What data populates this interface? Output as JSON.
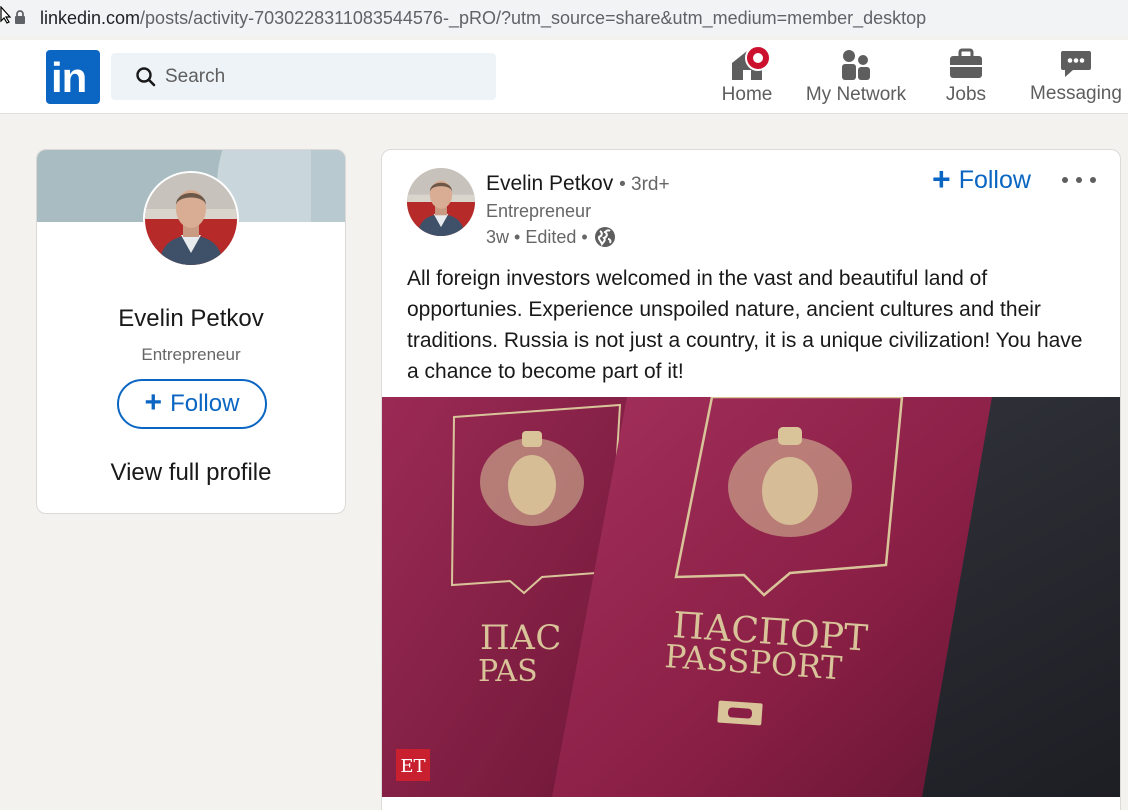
{
  "browser": {
    "url_host": "linkedin.com",
    "url_path": "/posts/activity-7030228311083544576-_pRO/?utm_source=share&utm_medium=member_desktop"
  },
  "nav": {
    "search_placeholder": "Search",
    "items": [
      {
        "label": "Home",
        "icon": "home-icon",
        "has_badge": true
      },
      {
        "label": "My Network",
        "icon": "network-icon"
      },
      {
        "label": "Jobs",
        "icon": "briefcase-icon"
      },
      {
        "label": "Messaging",
        "icon": "messaging-icon"
      }
    ]
  },
  "profile_card": {
    "name": "Evelin Petkov",
    "title": "Entrepreneur",
    "follow_label": "Follow",
    "view_profile_label": "View full profile"
  },
  "post": {
    "author_name": "Evelin Petkov",
    "degree": "• 3rd+",
    "author_title": "Entrepreneur",
    "meta": "3w • Edited •",
    "follow_label": "Follow",
    "text": "All foreign investors welcomed in the vast and beautiful land of opportunies. Experience unspoiled nature, ancient cultures and their traditions. Russia is not just a country, it is a unique civilization! You have a chance to become part of it!",
    "image": {
      "passport_ru": "ПАСПОРТ",
      "passport_en": "PASSPORT",
      "passport_ru_partial": "ПАС",
      "passport_en_partial": "PAS",
      "watermark": "ET"
    }
  },
  "colors": {
    "brand": "#0a66c2",
    "badge": "#cb112d",
    "passport": "#8a1f45",
    "gold": "#d9c49a"
  }
}
